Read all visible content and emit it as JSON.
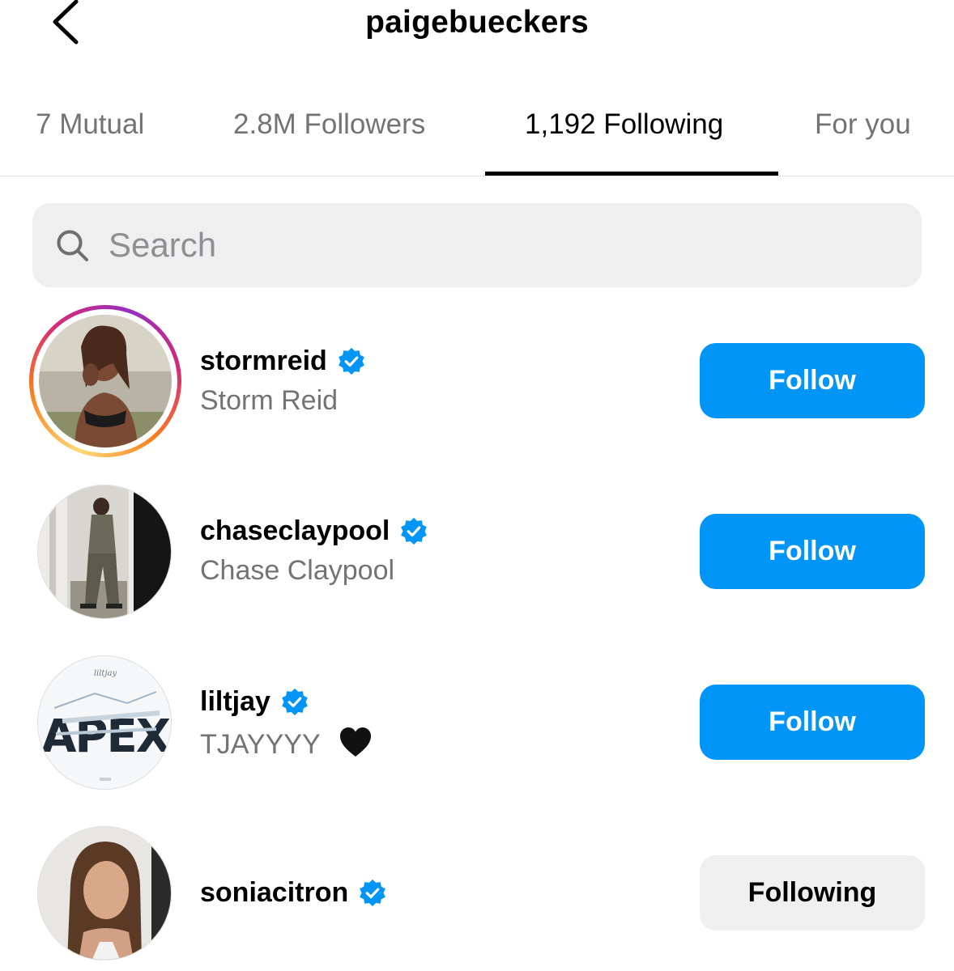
{
  "header": {
    "title": "paigebueckers"
  },
  "tabs": [
    {
      "label": "7 Mutual"
    },
    {
      "label": "2.8M Followers"
    },
    {
      "label": "1,192 Following",
      "active": true
    },
    {
      "label": "For you"
    }
  ],
  "search": {
    "placeholder": "Search",
    "value": ""
  },
  "accounts": [
    {
      "username": "stormreid",
      "full_name": "Storm Reid",
      "verified": true,
      "story_ring": true,
      "button": "Follow"
    },
    {
      "username": "chaseclaypool",
      "full_name": "Chase Claypool",
      "verified": true,
      "story_ring": false,
      "button": "Follow"
    },
    {
      "username": "liltjay",
      "full_name": "TJAYYYY",
      "full_name_emoji": "black-heart-icon",
      "verified": true,
      "story_ring": false,
      "button": "Follow"
    },
    {
      "username": "soniacitron",
      "full_name": "",
      "verified": true,
      "story_ring": false,
      "button": "Following"
    }
  ],
  "colors": {
    "follow_button": "#0095f6",
    "following_button": "#efefef",
    "verified_badge": "#0095f6",
    "secondary_text": "#737373"
  },
  "icons": {
    "back": "chevron-left-icon",
    "search": "search-icon",
    "verified": "verified-badge-icon"
  }
}
